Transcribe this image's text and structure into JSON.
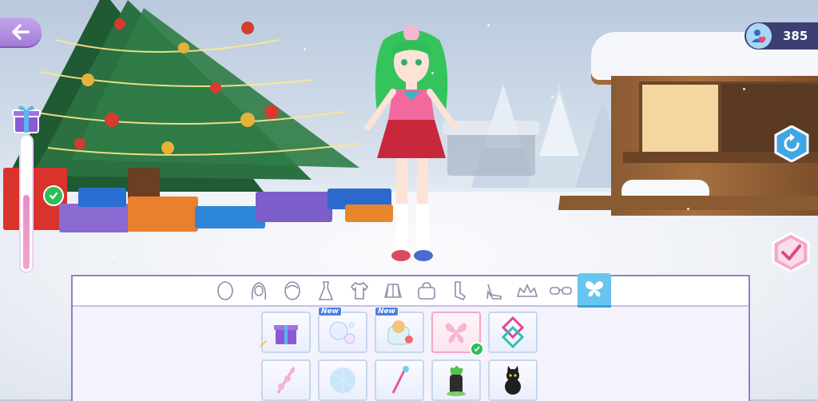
{
  "header": {
    "coins_value": "385"
  },
  "icons": {
    "back": "arrow-left-icon",
    "coins": "profile-heart-icon",
    "refresh": "refresh-icon",
    "confirm": "check-icon"
  },
  "tabs": [
    {
      "name": "skin",
      "icon": "face-skin-icon",
      "active": false
    },
    {
      "name": "hair",
      "icon": "hair-icon",
      "active": false
    },
    {
      "name": "face",
      "icon": "face-icon",
      "active": false
    },
    {
      "name": "dress",
      "icon": "dress-icon",
      "active": false
    },
    {
      "name": "top",
      "icon": "shirt-icon",
      "active": false
    },
    {
      "name": "skirt",
      "icon": "skirt-icon",
      "active": false
    },
    {
      "name": "bag",
      "icon": "bag-icon",
      "active": false
    },
    {
      "name": "socks",
      "icon": "socks-icon",
      "active": false
    },
    {
      "name": "shoes",
      "icon": "heel-shoe-icon",
      "active": false
    },
    {
      "name": "tiara",
      "icon": "tiara-icon",
      "active": false
    },
    {
      "name": "glasses",
      "icon": "glasses-icon",
      "active": false
    },
    {
      "name": "wings",
      "icon": "butterfly-icon",
      "active": true
    }
  ],
  "items": [
    {
      "icon": "gift-box-icon",
      "new": false,
      "selected": false
    },
    {
      "icon": "bubbles-icon",
      "new": true,
      "new_label": "New",
      "selected": false
    },
    {
      "icon": "cat-jar-icon",
      "new": true,
      "new_label": "New",
      "selected": false
    },
    {
      "icon": "pink-butterfly-icon",
      "new": false,
      "selected": true
    },
    {
      "icon": "diamond-pattern-icon",
      "new": false,
      "selected": false
    },
    {
      "icon": "flower-sparkle-icon",
      "new": false,
      "selected": false
    },
    {
      "icon": "snowflake-icon",
      "new": false,
      "selected": false
    },
    {
      "icon": "magic-wand-icon",
      "new": false,
      "selected": false
    },
    {
      "icon": "plant-pot-icon",
      "new": false,
      "selected": false
    },
    {
      "icon": "black-cat-icon",
      "new": false,
      "selected": false
    }
  ],
  "slider": {
    "level": 0.55
  },
  "colors": {
    "accent": "#67c5ef",
    "panel_border": "#8f7fd2",
    "back_button": "#b08ae0",
    "coin_bg": "#3d3f73"
  }
}
